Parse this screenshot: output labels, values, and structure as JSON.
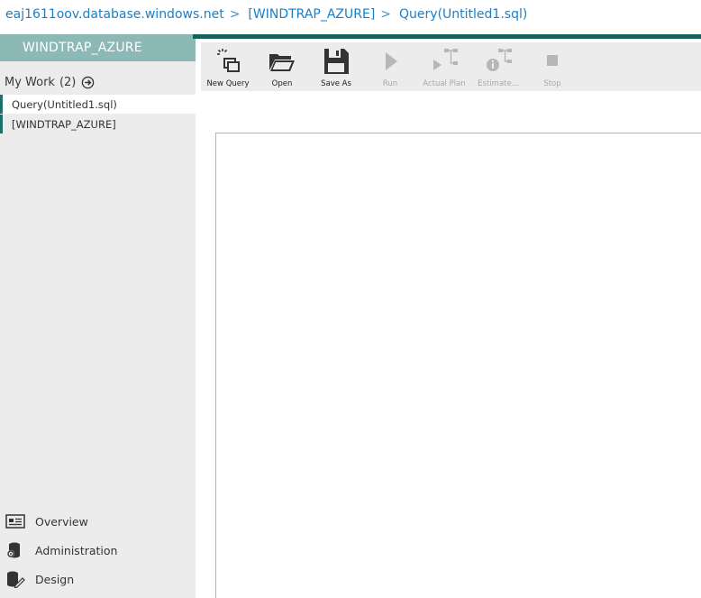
{
  "breadcrumb": {
    "server": "eaj1611oov.database.windows.net",
    "database": "[WINDTRAP_AZURE]",
    "query": "Query(Untitled1.sql)",
    "separator": ">"
  },
  "sidebar": {
    "header": "WINDTRAP_AZURE",
    "my_work_label": "My Work",
    "my_work_count": "(2)",
    "items": [
      {
        "label": "Query(Untitled1.sql)"
      },
      {
        "label": "[WINDTRAP_AZURE]"
      }
    ],
    "nav": {
      "overview": "Overview",
      "administration": "Administration",
      "design": "Design"
    }
  },
  "toolbar": {
    "new_query": "New Query",
    "open": "Open",
    "save_as": "Save As",
    "run": "Run",
    "actual_plan": "Actual Plan",
    "estimated": "Estimate...",
    "stop": "Stop"
  },
  "colors": {
    "accent": "#17615c",
    "sidebar_header": "#8cb9b6",
    "link": "#1b7fc6",
    "panel": "#ececec",
    "disabled": "#b7b7b7"
  }
}
